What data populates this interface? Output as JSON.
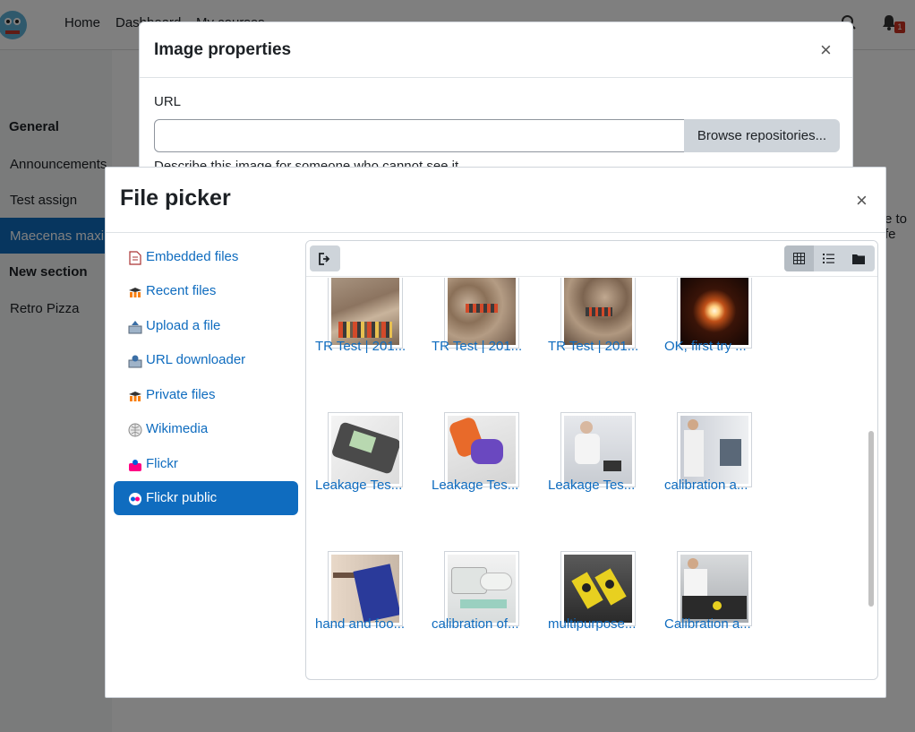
{
  "navbar": {
    "links": [
      "Home",
      "Dashboard",
      "My courses"
    ],
    "notification_count": "1"
  },
  "course_index": {
    "general": "General",
    "items": [
      "Announcements",
      "Test assign",
      "Maecenas maxi"
    ],
    "new_section": "New section",
    "new_items": [
      "Retro Pizza"
    ]
  },
  "page_right_text": "e to fe",
  "image_properties": {
    "title": "Image properties",
    "url_label": "URL",
    "url_value": "",
    "browse_label": "Browse repositories...",
    "describe_text": "Describe this image for someone who cannot see it"
  },
  "file_picker": {
    "title": "File picker",
    "repositories": [
      {
        "label": "Embedded files",
        "icon": "embedded-files-icon"
      },
      {
        "label": "Recent files",
        "icon": "moodle-icon"
      },
      {
        "label": "Upload a file",
        "icon": "upload-icon"
      },
      {
        "label": "URL downloader",
        "icon": "url-downloader-icon"
      },
      {
        "label": "Private files",
        "icon": "moodle-icon"
      },
      {
        "label": "Wikimedia",
        "icon": "wikimedia-icon"
      },
      {
        "label": "Flickr",
        "icon": "flickr-icon"
      },
      {
        "label": "Flickr public",
        "icon": "flickr-public-icon",
        "active": true
      }
    ],
    "files": [
      "TR Test | 201...",
      "TR Test | 201...",
      "TR Test | 201...",
      "OK, first try ...",
      "Leakage Tes...",
      "Leakage Tes...",
      "Leakage Tes...",
      "calibration a...",
      "hand and foo...",
      "calibration of...",
      "multipurpose...",
      "Calibration a..."
    ]
  },
  "colors": {
    "accent": "#0f6cbf",
    "overlay": "rgba(0,0,0,0.5)"
  }
}
